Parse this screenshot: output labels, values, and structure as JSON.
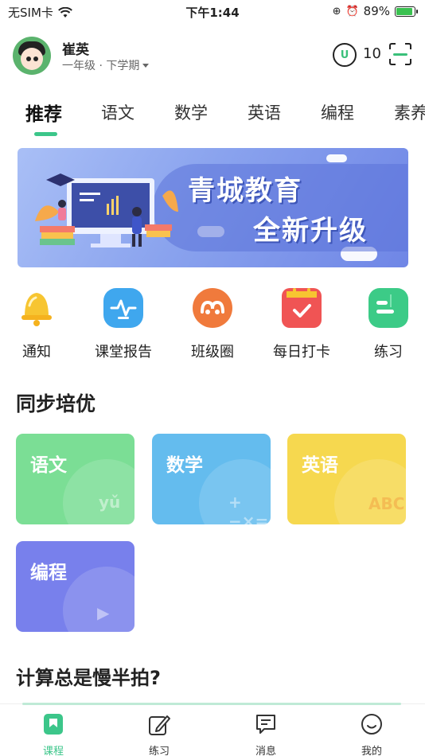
{
  "status_bar": {
    "carrier": "无SIM卡",
    "time": "下午1:44",
    "battery": "89%",
    "battery_level": 0.89
  },
  "header": {
    "user_name": "崔英",
    "grade": "一年级 · 下学期",
    "coin_letter": "U",
    "coin_count": "10"
  },
  "tabs": [
    {
      "label": "推荐",
      "active": true
    },
    {
      "label": "语文"
    },
    {
      "label": "数学"
    },
    {
      "label": "英语"
    },
    {
      "label": "编程"
    },
    {
      "label": "素养"
    }
  ],
  "banner": {
    "line1": "青城教育",
    "line2": "全新升级"
  },
  "quick_actions": [
    {
      "label": "通知",
      "icon": "bell-icon",
      "color": "#f7c531"
    },
    {
      "label": "课堂报告",
      "icon": "report-icon",
      "color": "#3fa7ee"
    },
    {
      "label": "班级圈",
      "icon": "class-circle-icon",
      "color": "#f07a3c"
    },
    {
      "label": "每日打卡",
      "icon": "calendar-check-icon",
      "color": "#f05454"
    },
    {
      "label": "练习",
      "icon": "practice-icon",
      "color": "#3ccb87"
    }
  ],
  "section": {
    "title": "同步培优",
    "cards": [
      {
        "label": "语文",
        "deco": "yǔ",
        "color": "#7bde95"
      },
      {
        "label": "数学",
        "deco": "+−×=",
        "color": "#64bcee"
      },
      {
        "label": "英语",
        "deco": "ABC",
        "color": "#f6d84f"
      },
      {
        "label": "编程",
        "deco": "▶",
        "color": "#7880ec"
      }
    ]
  },
  "promo": {
    "title": "计算总是慢半拍?"
  },
  "bottom_nav": [
    {
      "label": "课程",
      "icon": "course-icon",
      "active": true
    },
    {
      "label": "练习",
      "icon": "pencil-icon"
    },
    {
      "label": "消息",
      "icon": "message-icon"
    },
    {
      "label": "我的",
      "icon": "smile-icon"
    }
  ],
  "colors": {
    "accent": "#3cc68a",
    "banner": "#8aa3ee"
  }
}
